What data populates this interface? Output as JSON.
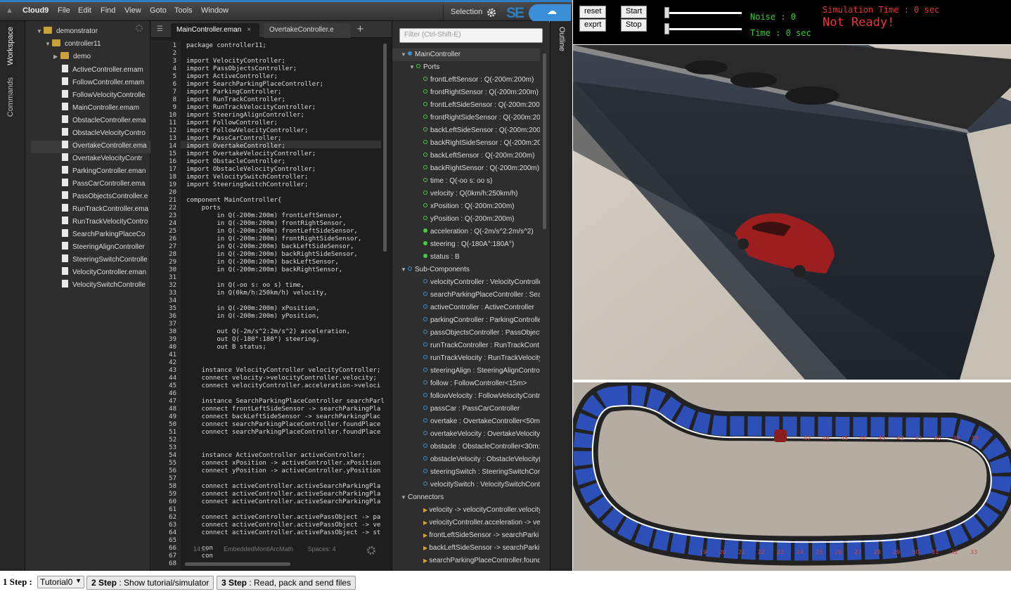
{
  "menubar": {
    "logo": "Cloud9",
    "items": [
      "File",
      "Edit",
      "Find",
      "View",
      "Goto",
      "Tools",
      "Window"
    ],
    "selection_label": "Selection",
    "se_logo": "SE"
  },
  "lefttabs": {
    "workspace": "Workspace",
    "commands": "Commands"
  },
  "filetree": {
    "root": "demonstrator",
    "folder": "controller11",
    "subfolder": "demo",
    "files": [
      "ActiveController.emam",
      "FollowController.emam",
      "FollowVelocityControlle",
      "MainController.emam",
      "ObstacleController.ema",
      "ObstacleVelocityContro",
      "OvertakeController.ema",
      "OvertakeVelocityContr",
      "ParkingController.eman",
      "PassCarController.ema",
      "PassObjectsController.e",
      "RunTrackController.ema",
      "RunTrackVelocityContro",
      "SearchParkingPlaceCo",
      "SteeringAlignController",
      "SteeringSwitchControlle",
      "VelocityController.eman",
      "VelocitySwitchControlle"
    ]
  },
  "editor": {
    "tabs": [
      "MainController.eman",
      "OvertakeController.e"
    ],
    "lines": [
      "package controller11;",
      "",
      "import VelocityController;",
      "import PassObjectsController;",
      "import ActiveController;",
      "import SearchParkingPlaceController;",
      "import ParkingController;",
      "import RunTrackController;",
      "import RunTrackVelocityController;",
      "import SteeringAlignController;",
      "import FollowController;",
      "import FollowVelocityController;",
      "import PassCarController;",
      "import OvertakeController;",
      "import OvertakeVelocityController;",
      "import ObstacleController;",
      "import ObstacleVelocityController;",
      "import VelocitySwitchController;",
      "import SteeringSwitchController;",
      "",
      "component MainController{",
      "    ports",
      "        in Q(-200m:200m) frontLeftSensor,",
      "        in Q(-200m:200m) frontRightSensor,",
      "        in Q(-200m:200m) frontLeftSideSensor,",
      "        in Q(-200m:200m) frontRightSideSensor,",
      "        in Q(-200m:200m) backLeftSideSensor,",
      "        in Q(-200m:200m) backRightSideSensor,",
      "        in Q(-200m:200m) backLeftSensor,",
      "        in Q(-200m:200m) backRightSensor,",
      "",
      "        in Q(-oo s: oo s) time,",
      "        in Q(0km/h:250km/h) velocity,",
      "",
      "        in Q(-200m:200m) xPosition,",
      "        in Q(-200m:200m) yPosition,",
      "",
      "        out Q(-2m/s^2:2m/s^2) acceleration,",
      "        out Q(-180°:180°) steering,",
      "        out B status;",
      "",
      "",
      "    instance VelocityController velocityController;",
      "    connect velocity->velocityController.velocity;",
      "    connect velocityController.acceleration->veloci",
      "",
      "    instance SearchParkingPlaceController searchParl",
      "    connect frontLeftSideSensor -> searchParkingPla",
      "    connect backLeftSideSensor -> searchParkingPlac",
      "    connect searchParkingPlaceController.foundPlace",
      "    connect searchParkingPlaceController.foundPlace",
      "",
      "",
      "    instance ActiveController activeController;",
      "    connect xPosition -> activeController.xPosition",
      "    connect yPosition -> activeController.yPosition",
      "",
      "    connect activeController.activeSearchParkingPla",
      "    connect activeController.activeSearchParkingPla",
      "    connect activeController.activeSearchParkingPla",
      "",
      "    connect activeController.activePassObject -> pa",
      "    connect activeController.activePassObject -> ve",
      "    connect activeController.activePassObject -> st",
      "",
      "    con",
      "    con",
      ""
    ],
    "status_pos": "14:27",
    "status_lang": "EmbeddedMontiArcMath",
    "status_spaces": "Spaces: 4"
  },
  "outline": {
    "filter_placeholder": "Filter (Ctrl-Shift-E)",
    "root": "MainController",
    "ports_label": "Ports",
    "ports": [
      {
        "text": "frontLeftSensor : Q(-200m:200m)",
        "out": false
      },
      {
        "text": "frontRightSensor : Q(-200m:200m)",
        "out": false
      },
      {
        "text": "frontLeftSideSensor : Q(-200m:200",
        "out": false
      },
      {
        "text": "frontRightSideSensor : Q(-200m:20",
        "out": false
      },
      {
        "text": "backLeftSideSensor : Q(-200m:200",
        "out": false
      },
      {
        "text": "backRightSideSensor : Q(-200m:20",
        "out": false
      },
      {
        "text": "backLeftSensor : Q(-200m:200m)",
        "out": false
      },
      {
        "text": "backRightSensor : Q(-200m:200m)",
        "out": false
      },
      {
        "text": "time : Q(-oo s: oo s)",
        "out": false
      },
      {
        "text": "velocity : Q(0km/h:250km/h)",
        "out": false
      },
      {
        "text": "xPosition : Q(-200m:200m)",
        "out": false
      },
      {
        "text": "yPosition : Q(-200m:200m)",
        "out": false
      },
      {
        "text": "acceleration : Q(-2m/s^2:2m/s^2)",
        "out": true
      },
      {
        "text": "steering : Q(-180Â°:180Â°)",
        "out": true
      },
      {
        "text": "status : B",
        "out": true
      }
    ],
    "subcomponents_label": "Sub-Components",
    "subcomponents": [
      "velocityController : VelocityControlle",
      "searchParkingPlaceController : Sea",
      "activeController : ActiveController",
      "parkingController : ParkingController",
      "passObjectsController : PassObject",
      "runTrackController : RunTrackCont",
      "runTrackVelocity : RunTrackVelocity",
      "steeringAlign : SteeringAlignControl",
      "follow : FollowController<15m>",
      "followVelocity : FollowVelocityContr",
      "passCar : PassCarController",
      "overtake : OvertakeController<50m",
      "overtakeVelocity : OvertakeVelocity",
      "obstacle : ObstacleController<30m:",
      "obstacleVelocity : ObstacleVelocity(",
      "steeringSwitch : SteeringSwitchCor",
      "velocitySwitch : VelocitySwitchCont"
    ],
    "connectors_label": "Connectors",
    "connectors": [
      "velocity -> velocityController.velocity",
      "velocityController.acceleration -> ve",
      "frontLeftSideSensor -> searchParki",
      "backLeftSideSensor -> searchParki",
      "searchParkingPlaceController.found"
    ]
  },
  "outline_tab": "Outline",
  "sim": {
    "reset": "reset",
    "export": "exprt",
    "start": "Start",
    "stop": "Stop",
    "noise": "Noise : 0",
    "time": "Time : 0 sec",
    "sim_time": "Simulation Time : 0 sec",
    "status": "Not Ready!",
    "track_numbers_top": [
      "47",
      "46",
      "45",
      "44",
      "43",
      "42",
      "41",
      "40",
      "39",
      "38"
    ],
    "track_numbers_bottom": [
      "19",
      "20",
      "21",
      "22",
      "23",
      "24",
      "25",
      "26",
      "27",
      "28",
      "29",
      "30",
      "31",
      "32",
      "33"
    ]
  },
  "bottom": {
    "step1_label": "1 Step :",
    "step1_select": "Tutorial0",
    "step2_bold": "2 Step",
    "step2_text": " : Show tutorial/simulator",
    "step3_bold": "3 Step",
    "step3_text": " : Read, pack and send files"
  },
  "colors": {
    "accent": "#2e7ec4",
    "sim_green": "#33cc33",
    "sim_red": "#ee3333"
  }
}
